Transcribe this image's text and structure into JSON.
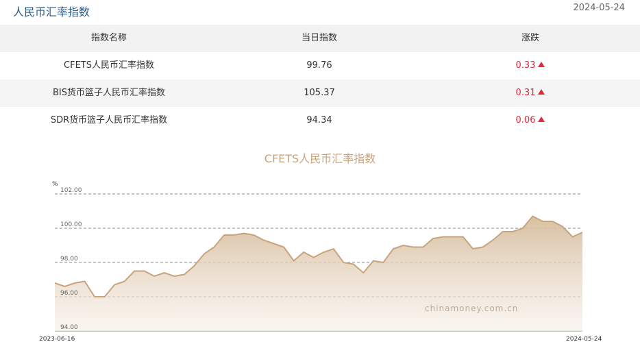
{
  "header": {
    "title": "人民币汇率指数",
    "date": "2024-05-24"
  },
  "table": {
    "columns": [
      "指数名称",
      "当日指数",
      "涨跌"
    ],
    "rows": [
      {
        "name": "CFETS人民币汇率指数",
        "value": "99.76",
        "change": "0.33"
      },
      {
        "name": "BIS货币篮子人民币汇率指数",
        "value": "105.37",
        "change": "0.31"
      },
      {
        "name": "SDR货币篮子人民币汇率指数",
        "value": "94.34",
        "change": "0.06"
      }
    ]
  },
  "watermark": "chinamoney.com.cn",
  "colors": {
    "up": "#e0283a",
    "line": "#c8a47c",
    "title": "#2b5c8e"
  },
  "chart_data": {
    "type": "area",
    "title": "CFETS人民币汇率指数",
    "ylabel": "%",
    "ylim": [
      94,
      102
    ],
    "yticks": [
      "102.00",
      "100.00",
      "98.00",
      "96.00",
      "94.00"
    ],
    "x_start": "2023-06-16",
    "x_end": "2024-05-24",
    "grid": true,
    "values": [
      96.8,
      96.6,
      96.8,
      96.9,
      96.0,
      96.0,
      96.7,
      96.9,
      97.5,
      97.5,
      97.2,
      97.4,
      97.2,
      97.3,
      97.8,
      98.5,
      98.9,
      99.6,
      99.6,
      99.7,
      99.6,
      99.3,
      99.1,
      98.9,
      98.1,
      98.6,
      98.3,
      98.6,
      98.8,
      98.0,
      97.9,
      97.4,
      98.1,
      98.0,
      98.8,
      99.0,
      98.9,
      98.9,
      99.4,
      99.5,
      99.5,
      99.5,
      98.8,
      98.9,
      99.3,
      99.8,
      99.8,
      100.0,
      100.7,
      100.4,
      100.4,
      100.1,
      99.5,
      99.76
    ]
  }
}
